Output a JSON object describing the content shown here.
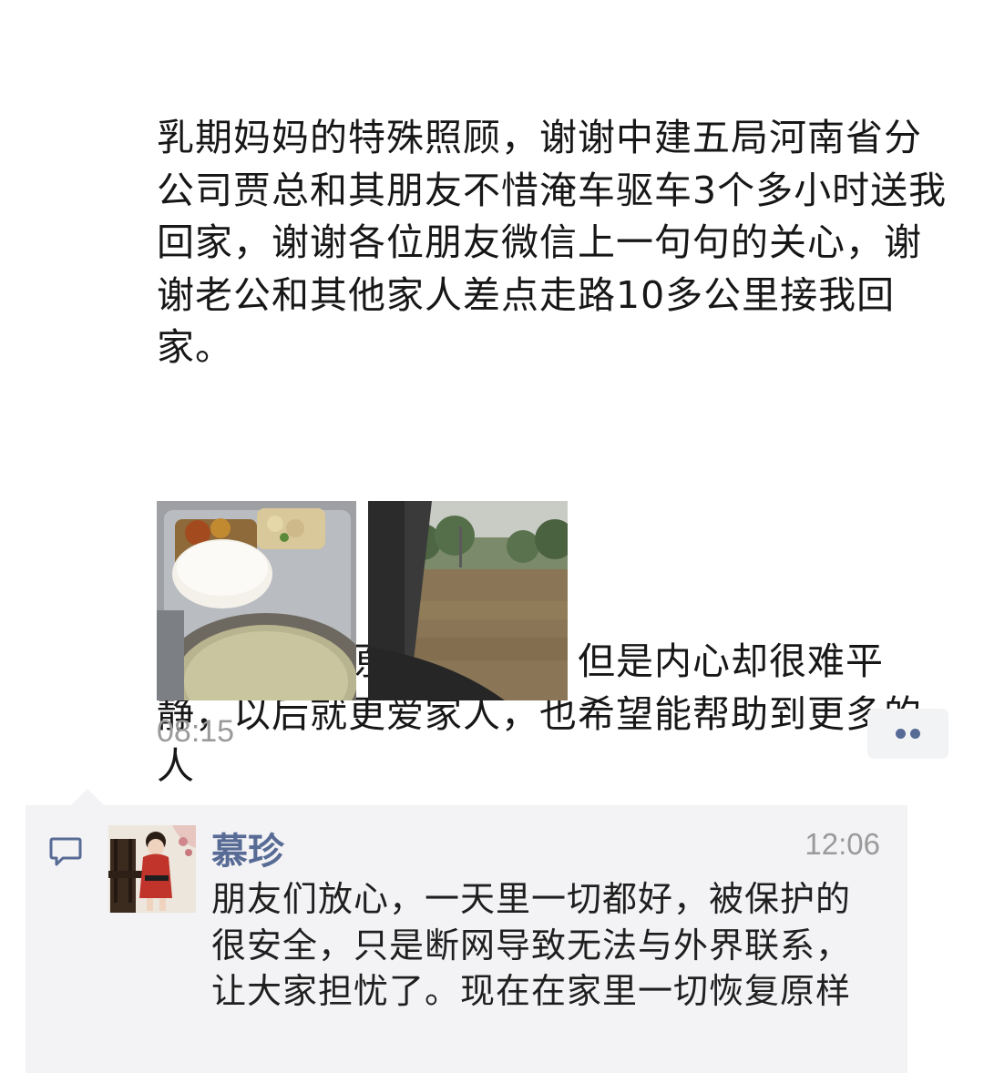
{
  "post": {
    "paragraph1": "乳期妈妈的特殊照顾，谢谢中建五局河南省分公司贾总和其朋友不惜淹车驱车3个多小时送我回家，谢谢各位朋友微信上一句句的关心，谢谢老公和其他家人差点走路10多公里接我回家。",
    "paragraph2": "一切都恢复原来的模样，但是内心却很难平静，以后就更爱家人，也希望能帮助到更多的人",
    "timestamp": "08:15",
    "images": [
      {
        "icon": "meal-photo"
      },
      {
        "icon": "flood-photo"
      }
    ]
  },
  "actions": {
    "more_icon": "more-dots-icon",
    "accent": "#576b95"
  },
  "comments": [
    {
      "name": "慕珍",
      "time": "12:06",
      "text": "朋友们放心，一天里一切都好，被保护的很安全，只是断网导致无法与外界联系，让大家担忧了。现在在家里一切恢复原样"
    }
  ]
}
